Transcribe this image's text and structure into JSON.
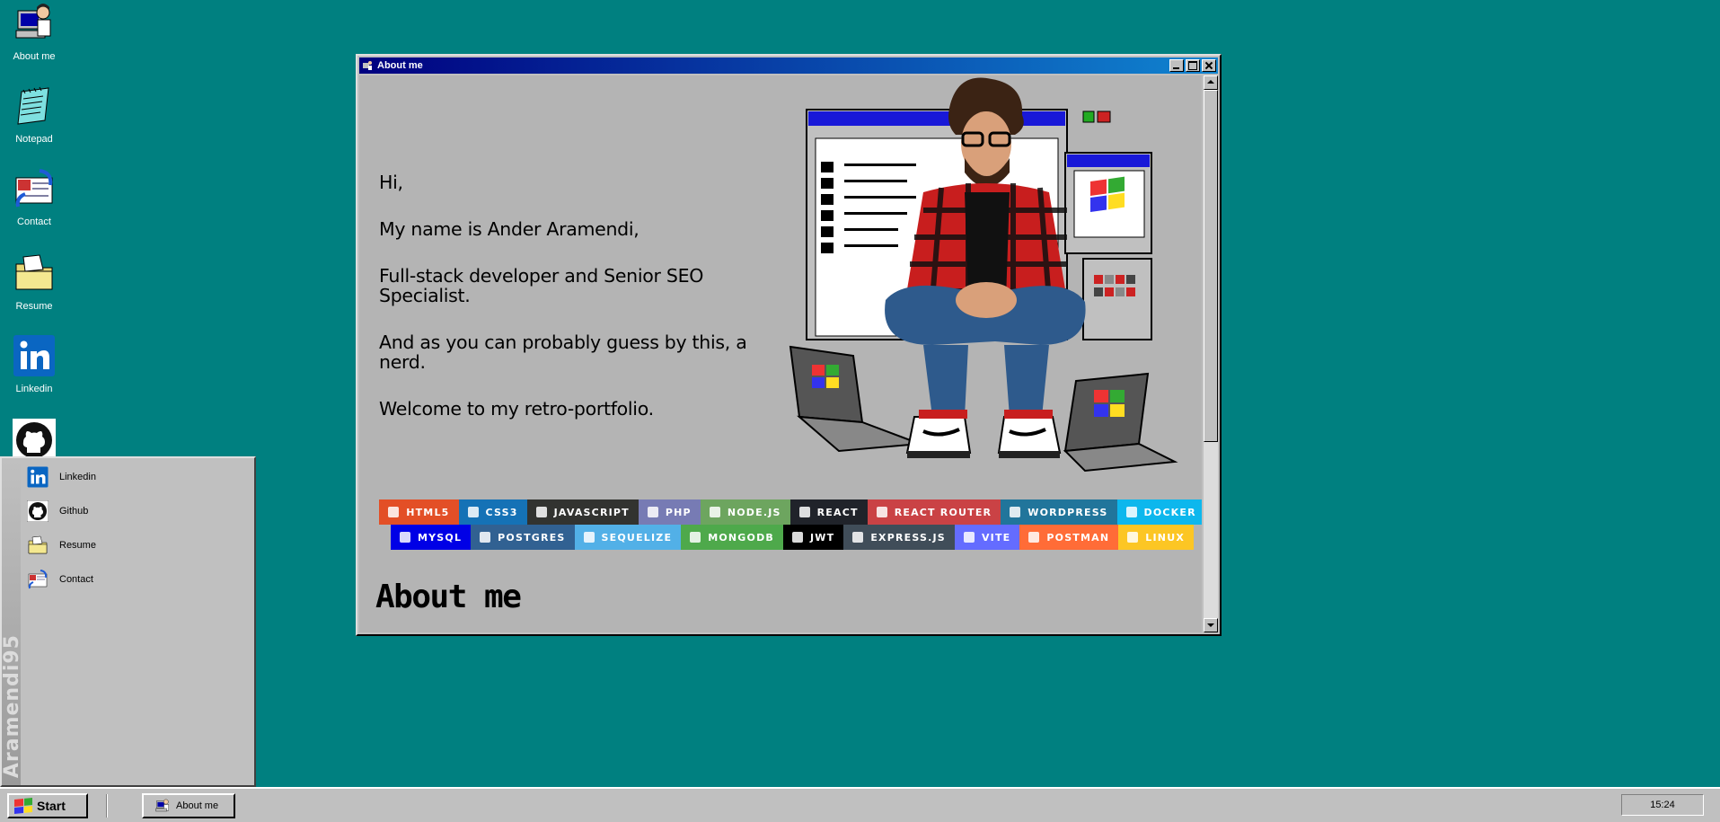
{
  "desktop": {
    "icons": [
      {
        "label": "About me",
        "icon": "computer-user-icon"
      },
      {
        "label": "Notepad",
        "icon": "notepad-icon"
      },
      {
        "label": "Contact",
        "icon": "contact-card-icon"
      },
      {
        "label": "Resume",
        "icon": "folder-icon"
      },
      {
        "label": "Linkedin",
        "icon": "linkedin-icon"
      },
      {
        "label": "",
        "icon": "github-icon"
      }
    ]
  },
  "window": {
    "title": "About me",
    "intro": [
      "Hi,",
      "My name is Ander Aramendi,",
      "Full-stack developer and Senior SEO Specialist.",
      "And as you can probably guess by this, a nerd.",
      "Welcome to my retro-portfolio."
    ],
    "heading": "About me",
    "badges_row1": [
      {
        "label": "HTML5",
        "color": "#e34f26"
      },
      {
        "label": "CSS3",
        "color": "#1572b6"
      },
      {
        "label": "JAVASCRIPT",
        "color": "#323330"
      },
      {
        "label": "PHP",
        "color": "#777bb4"
      },
      {
        "label": "NODE.JS",
        "color": "#6da55f"
      },
      {
        "label": "REACT",
        "color": "#20232a"
      },
      {
        "label": "REACT ROUTER",
        "color": "#ca4245"
      },
      {
        "label": "WORDPRESS",
        "color": "#21759b"
      },
      {
        "label": "DOCKER",
        "color": "#0db7ed"
      }
    ],
    "badges_row2": [
      {
        "label": "MYSQL",
        "color": "#0000e6"
      },
      {
        "label": "POSTGRES",
        "color": "#316192"
      },
      {
        "label": "SEQUELIZE",
        "color": "#52b0e7"
      },
      {
        "label": "MONGODB",
        "color": "#4ea94b"
      },
      {
        "label": "JWT",
        "color": "#000000"
      },
      {
        "label": "EXPRESS.JS",
        "color": "#404d59"
      },
      {
        "label": "VITE",
        "color": "#646cff"
      },
      {
        "label": "POSTMAN",
        "color": "#ff6c37"
      },
      {
        "label": "LINUX",
        "color": "#fcc624"
      }
    ]
  },
  "start_menu": {
    "brand": "Aramendi95",
    "items": [
      {
        "label": "Linkedin",
        "icon": "linkedin-icon"
      },
      {
        "label": "Github",
        "icon": "github-icon"
      },
      {
        "label": "Resume",
        "icon": "folder-icon"
      },
      {
        "label": "Contact",
        "icon": "contact-card-icon"
      }
    ]
  },
  "taskbar": {
    "start_label": "Start",
    "task_label": "About me",
    "clock": "15:24"
  },
  "colors": {
    "desktop": "#008080",
    "title_start": "#000080",
    "title_end": "#1084d0"
  }
}
